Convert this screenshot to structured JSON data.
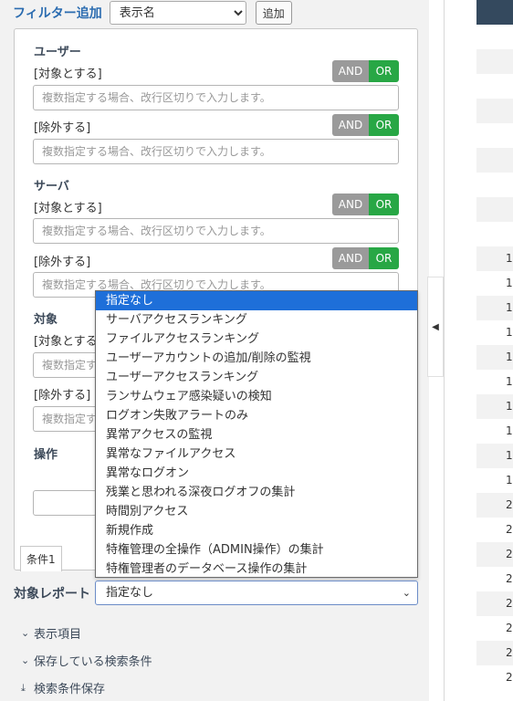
{
  "filter": {
    "label": "フィルター追加",
    "select_value": "表示名",
    "add_label": "追加"
  },
  "sections": {
    "user": {
      "title": "ユーザー",
      "include_label": "[対象とする]",
      "include_placeholder": "複数指定する場合、改行区切りで入力します。",
      "exclude_label": "[除外する]",
      "exclude_placeholder": "複数指定する場合、改行区切りで入力します。"
    },
    "server": {
      "title": "サーバ",
      "include_label": "[対象とする]",
      "include_placeholder": "複数指定する場合、改行区切りで入力します。",
      "exclude_label": "[除外する]",
      "exclude_placeholder": "複数指定する場合、改行区切りで入力します。"
    },
    "target": {
      "title": "対象",
      "include_label": "[対象とする]",
      "include_placeholder": "複数指定す",
      "exclude_label": "[除外する]",
      "exclude_placeholder": "複数指定す"
    },
    "operation": {
      "title": "操作"
    }
  },
  "toggle": {
    "and": "AND",
    "or": "OR"
  },
  "condition_tab": "条件1",
  "collapse_glyph": "◀",
  "dropdown": {
    "options": [
      "指定なし",
      "サーバアクセスランキング",
      "ファイルアクセスランキング",
      "ユーザーアカウントの追加/削除の監視",
      "ユーザーアクセスランキング",
      "ランサムウェア感染疑いの検知",
      "ログオン失敗アラートのみ",
      "異常アクセスの監視",
      "異常なファイルアクセス",
      "異常なログオン",
      "残業と思われる深夜ログオフの集計",
      "時間別アクセス",
      "新規作成",
      "特権管理の全操作（ADMIN操作）の集計",
      "特権管理者のデータベース操作の集計"
    ],
    "selected": "指定なし"
  },
  "report": {
    "label": "対象レポート",
    "value": "指定なし"
  },
  "links": {
    "display_items": "表示項目",
    "saved_conditions": "保存している検索条件",
    "save_conditions": "検索条件保存"
  },
  "right_table": {
    "rows": [
      "",
      "",
      "",
      "",
      "",
      "",
      "",
      "",
      "",
      "1",
      "1",
      "1",
      "1",
      "1",
      "1",
      "1",
      "1",
      "1",
      "1",
      "2",
      "2",
      "2",
      "2",
      "2",
      "2",
      "2",
      "2"
    ]
  }
}
